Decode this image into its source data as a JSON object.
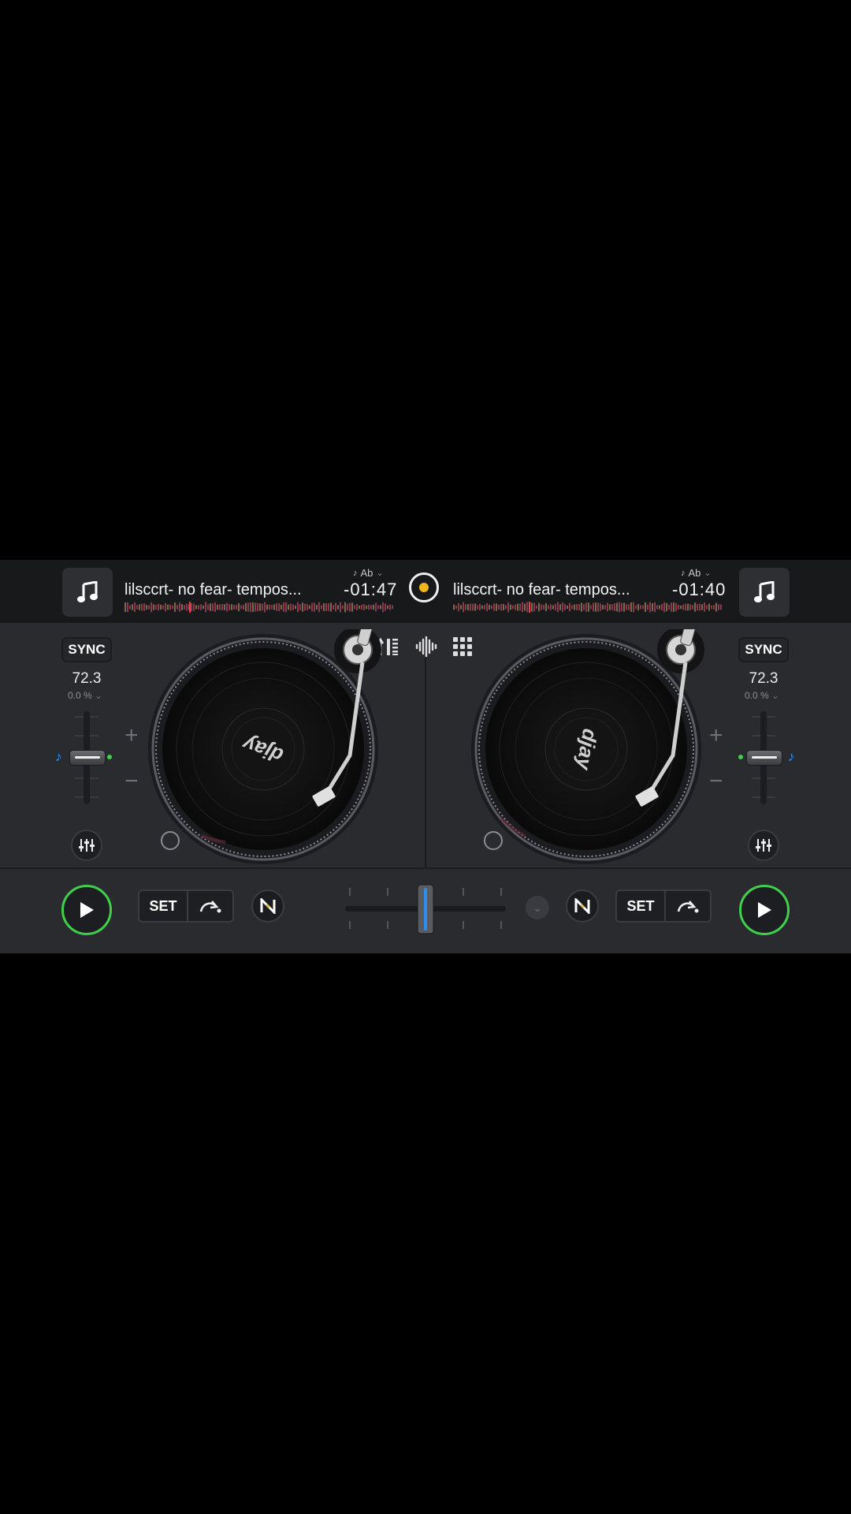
{
  "colors": {
    "background": "#000000",
    "panel": "#2a2b2f",
    "topbar": "#18191b",
    "play_accent": "#3fd04a",
    "record_dot": "#f2b51e",
    "crossfader_accent": "#2b8ff0",
    "pitch_note": "#3b8cf5",
    "pitch_dot": "#3fd04a"
  },
  "deck_left": {
    "library_icon": "music-note-icon",
    "track_title": "lilsccrt- no fear- tempos...",
    "time_remaining": "-01:47",
    "key": "Ab",
    "sync_label": "SYNC",
    "bpm": "72.3",
    "pitch_percent": "0.0 %",
    "plus_label": "+",
    "minus_label": "−",
    "record_label": "djay",
    "set_label": "SET",
    "pitch_fader_level": 0.5
  },
  "deck_right": {
    "library_icon": "music-note-icon",
    "track_title": "lilsccrt- no fear- tempos...",
    "time_remaining": "-01:40",
    "key": "Ab",
    "sync_label": "SYNC",
    "bpm": "72.3",
    "pitch_percent": "0.0 %",
    "plus_label": "+",
    "minus_label": "−",
    "record_label": "djay",
    "set_label": "SET",
    "pitch_fader_level": 0.5
  },
  "center": {
    "record_icon": "record-icon",
    "top_icons": [
      "mixer-icon",
      "waveform-icon",
      "grid-icon"
    ],
    "crossfader_position": 0.5
  }
}
